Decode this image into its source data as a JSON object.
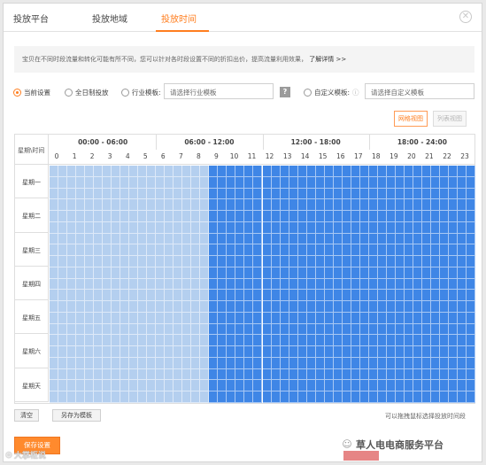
{
  "tabs": [
    {
      "label": "投放平台"
    },
    {
      "label": "投放地域"
    },
    {
      "label": "投放时间"
    }
  ],
  "active_tab": 2,
  "notice": {
    "text": "宝贝在不同时段流量和转化可能有所不同，您可以针对各时段设置不同的折扣出价，提高流量利用效果，",
    "link": "了解详情 >>"
  },
  "options": {
    "current": "当前设置",
    "all_day": "全日制投放",
    "industry": "行业模板:",
    "industry_placeholder": "请选择行业模板",
    "help_icon": "question-icon",
    "custom": "自定义模板:",
    "custom_placeholder": "请选择自定义模板"
  },
  "views": {
    "grid": "网格视图",
    "list": "列表视图"
  },
  "schedule": {
    "corner_label": "星期\\时间",
    "groups": [
      "00:00 - 06:00",
      "06:00 - 12:00",
      "12:00 - 18:00",
      "18:00 - 24:00"
    ],
    "hours": [
      "0",
      "1",
      "2",
      "3",
      "4",
      "5",
      "6",
      "7",
      "8",
      "9",
      "10",
      "11",
      "12",
      "13",
      "14",
      "15",
      "16",
      "17",
      "18",
      "19",
      "20",
      "21",
      "22",
      "23"
    ],
    "days": [
      "星期一",
      "星期二",
      "星期三",
      "星期四",
      "星期五",
      "星期六",
      "星期天"
    ],
    "light_until_hour": 9,
    "colors": {
      "light": "#b4cfef",
      "dark": "#3f86e6"
    }
  },
  "buttons": {
    "clear": "清空",
    "save_template": "另存为模板",
    "hint": "可以拖拽鼠标选择投放时间段",
    "save": "保存设置"
  },
  "watermarks": {
    "left": "大掌柜说",
    "right": "草人电电商服务平台"
  }
}
